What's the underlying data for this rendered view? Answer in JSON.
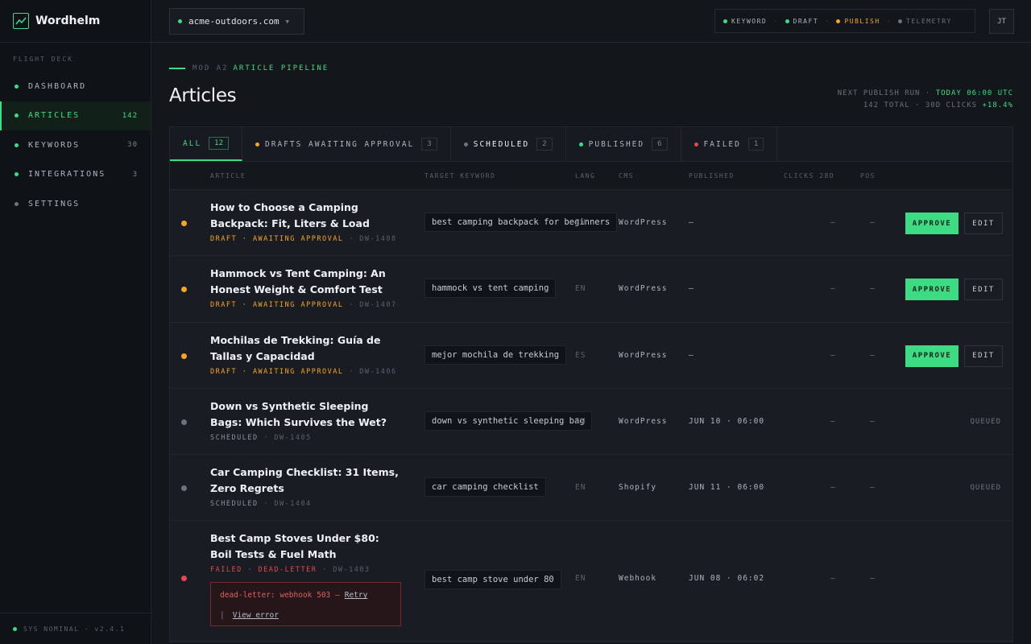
{
  "brand": {
    "name": "Wordhelm"
  },
  "sidebar": {
    "section": "FLIGHT DECK",
    "items": [
      {
        "label": "DASHBOARD",
        "count": ""
      },
      {
        "label": "ARTICLES",
        "count": "142"
      },
      {
        "label": "KEYWORDS",
        "count": "30"
      },
      {
        "label": "INTEGRATIONS",
        "count": "3"
      },
      {
        "label": "SETTINGS",
        "count": ""
      }
    ],
    "status": "SYS NOMINAL · v2.4.1"
  },
  "topbar": {
    "domain": "acme-outdoors.com",
    "pipeline": [
      {
        "label": "KEYWORD",
        "color": "#3ddc84"
      },
      {
        "label": "DRAFT",
        "color": "#3ddc84"
      },
      {
        "label": "PUBLISH",
        "color": "#f5a623"
      },
      {
        "label": "TELEMETRY",
        "color": "#6b7280"
      }
    ],
    "avatar": "JT"
  },
  "page": {
    "crumb_prefix": "MOD A2",
    "crumb": "ARTICLE PIPELINE",
    "title": "Articles",
    "next_run_label": "NEXT PUBLISH RUN ·",
    "next_run_value": "TODAY 06:00 UTC",
    "totals": "142 TOTAL · 30D CLICKS",
    "delta": "+18.4%"
  },
  "tabs": [
    {
      "label": "ALL",
      "count": "12"
    },
    {
      "label": "DRAFTS AWAITING APPROVAL",
      "count": "3"
    },
    {
      "label": "SCHEDULED",
      "count": "2"
    },
    {
      "label": "PUBLISHED",
      "count": "6"
    },
    {
      "label": "FAILED",
      "count": "1"
    }
  ],
  "columns": {
    "article": "ARTICLE",
    "keyword": "TARGET KEYWORD",
    "lang": "LANG",
    "cms": "CMS",
    "published": "PUBLISHED",
    "clicks": "CLICKS 28D",
    "pos": "POS"
  },
  "rows": [
    {
      "title": "How to Choose a Camping Backpack: Fit, Liters & Load",
      "state": "DRAFT · AWAITING APPROVAL",
      "id": "· DW-1408",
      "keyword": "best camping backpack for beginners",
      "lang": "EN",
      "cms": "WordPress",
      "published": "—",
      "clicks": "—",
      "pos": "—"
    },
    {
      "title": "Hammock vs Tent Camping: An Honest Weight & Comfort Test",
      "state": "DRAFT · AWAITING APPROVAL",
      "id": "· DW-1407",
      "keyword": "hammock vs tent camping",
      "lang": "EN",
      "cms": "WordPress",
      "published": "—",
      "clicks": "—",
      "pos": "—"
    },
    {
      "title": "Mochilas de Trekking: Guía de Tallas y Capacidad",
      "state": "DRAFT · AWAITING APPROVAL",
      "id": "· DW-1406",
      "keyword": "mejor mochila de trekking",
      "lang": "ES",
      "cms": "WordPress",
      "published": "—",
      "clicks": "—",
      "pos": "—"
    },
    {
      "title": "Down vs Synthetic Sleeping Bags: Which Survives the Wet?",
      "state": "SCHEDULED",
      "id": "· DW-1405",
      "keyword": "down vs synthetic sleeping bag",
      "lang": "EN",
      "cms": "WordPress",
      "published": "JUN 10 · 06:00",
      "clicks": "—",
      "pos": "—",
      "action": "QUEUED"
    },
    {
      "title": "Car Camping Checklist: 31 Items, Zero Regrets",
      "state": "SCHEDULED",
      "id": "· DW-1404",
      "keyword": "car camping checklist",
      "lang": "EN",
      "cms": "Shopify",
      "published": "JUN 11 · 06:00",
      "clicks": "—",
      "pos": "—",
      "action": "QUEUED"
    },
    {
      "title": "Best Camp Stoves Under $80: Boil Tests & Fuel Math",
      "state": "FAILED · DEAD-LETTER",
      "id": "· DW-1403",
      "keyword": "best camp stove under 80",
      "lang": "EN",
      "cms": "Webhook",
      "published": "JUN 08 · 06:02",
      "clicks": "—",
      "pos": "—",
      "error": "dead-letter: webhook 503 —",
      "retry": "Retry",
      "view_error": "View error",
      "pipe": "|"
    }
  ],
  "actions": {
    "approve": "APPROVE",
    "edit": "EDIT"
  }
}
